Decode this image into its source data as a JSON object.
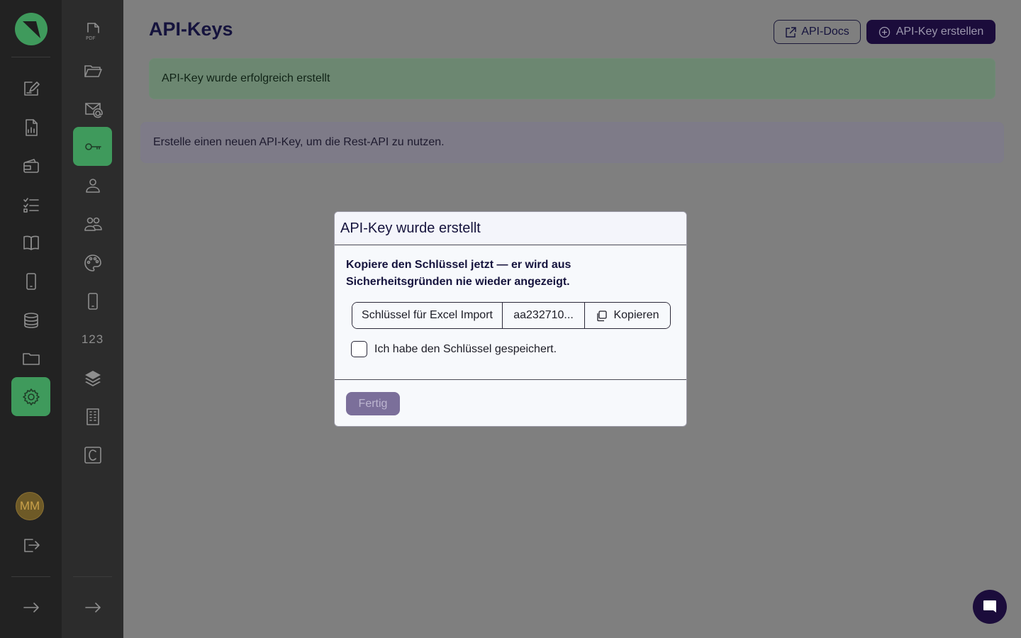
{
  "page": {
    "title": "API-Keys",
    "docs_button": "API-Docs",
    "create_button": "API-Key erstellen",
    "success_message": "API-Key wurde erfolgreich erstellt",
    "info_message": "Erstelle einen neuen API-Key, um die Rest-API zu nutzen."
  },
  "modal": {
    "title": "API-Key wurde erstellt",
    "warning": "Kopiere den Schlüssel jetzt — er wird aus Sicherheitsgründen nie wieder angezeigt.",
    "key_name": "Schlüssel für Excel Import",
    "key_value": "aa232710...",
    "copy_label": "Kopieren",
    "checkbox_label": "Ich habe den Schlüssel gespeichert.",
    "checkbox_checked": false,
    "done_label": "Fertig"
  },
  "user": {
    "initials": "MM"
  },
  "sidebar_secondary": {
    "numbers_label": "123"
  },
  "colors": {
    "accent_green": "#3f9a5c",
    "primary_dark": "#1b0c3b",
    "sidebar_dark": "#222222"
  },
  "icons": {
    "primary_rail": [
      "logo",
      "edit-document-icon",
      "document-chart-icon",
      "wallet-icon",
      "checklist-icon",
      "book-icon",
      "phone-icon",
      "database-icon",
      "folder-icon",
      "settings-icon",
      "logout-icon",
      "expand-arrow-icon"
    ],
    "secondary_rail": [
      "pdf-icon",
      "folder-open-icon",
      "mail-at-icon",
      "key-icon",
      "person-icon",
      "people-icon",
      "palette-icon",
      "phone-icon",
      "numbers-icon",
      "layers-icon",
      "building-icon",
      "c-box-icon",
      "expand-arrow-icon"
    ]
  }
}
